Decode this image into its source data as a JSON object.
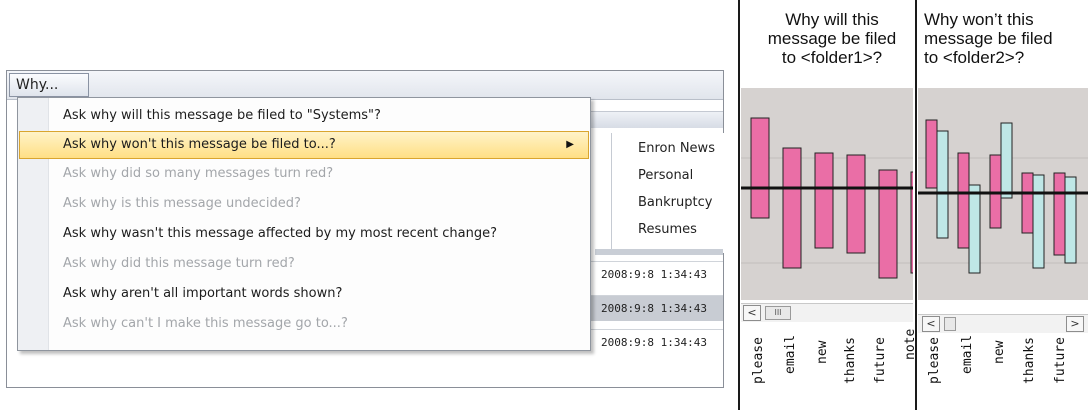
{
  "menu": {
    "why_button": "Why...",
    "items": [
      {
        "label": "Ask why will this message be filed to \"Systems\"?",
        "enabled": true
      },
      {
        "label": "Ask why won't this message be filed to...?",
        "enabled": true,
        "highlighted": true,
        "has_submenu": true
      },
      {
        "label": "Ask why did so many messages turn red?",
        "enabled": false
      },
      {
        "label": "Ask why is this message undecided?",
        "enabled": false
      },
      {
        "label": "Ask why wasn't this message affected by my most recent change?",
        "enabled": true
      },
      {
        "label": "Ask why did this message turn red?",
        "enabled": false
      },
      {
        "label": "Ask why aren't all important words shown?",
        "enabled": true
      },
      {
        "label": "Ask why can't I make this message go to...?",
        "enabled": false
      }
    ],
    "submenu_arrow": "▶"
  },
  "submenu": {
    "items": [
      "Enron News",
      "Personal",
      "Bankruptcy",
      "Resumes"
    ]
  },
  "message_rows": [
    {
      "date": "2008:9:8 1:34:43",
      "selected": false
    },
    {
      "date": "2008:9:8 1:34:43",
      "selected": true
    },
    {
      "date": "2008:9:8 1:34:43",
      "selected": false
    }
  ],
  "colors": {
    "pink": "#ea6ea6",
    "cyan": "#bfe7e6",
    "plot_bg": "#d6d2d0",
    "highlight": "#ffe59a"
  },
  "panels": [
    {
      "title_lines": [
        "Why will this",
        "message be filed",
        "to <folder1>?"
      ],
      "scroll_thumb": "III",
      "words": [
        "please",
        "email",
        "new",
        "thanks",
        "future",
        "note"
      ]
    },
    {
      "title_lines": [
        "Why won’t this",
        "message be filed",
        "to <folder2>?"
      ],
      "words": [
        "please",
        "email",
        "new",
        "thanks",
        "future"
      ]
    }
  ],
  "chart_data": [
    {
      "type": "bar",
      "categories": [
        "please",
        "email",
        "new",
        "thanks",
        "future",
        "note"
      ],
      "series": [
        {
          "values": [
            0.7,
            0.4,
            0.35,
            0.33,
            0.18,
            0.16
          ]
        },
        {
          "values": [
            -0.3,
            -0.8,
            -0.6,
            -0.65,
            -0.9,
            -0.85
          ]
        }
      ],
      "baseline": 0
    },
    {
      "type": "bar",
      "categories": [
        "please",
        "email",
        "new",
        "thanks",
        "future"
      ],
      "series": [
        {
          "values": [
            0.73,
            0.4,
            0.38,
            0.2,
            0.2
          ]
        },
        {
          "values": [
            0.62,
            0.08,
            0.7,
            0.18,
            0.16
          ]
        }
      ],
      "baseline": 0
    }
  ],
  "scrollbar_arrows": {
    "left": "<",
    "right": ">"
  }
}
